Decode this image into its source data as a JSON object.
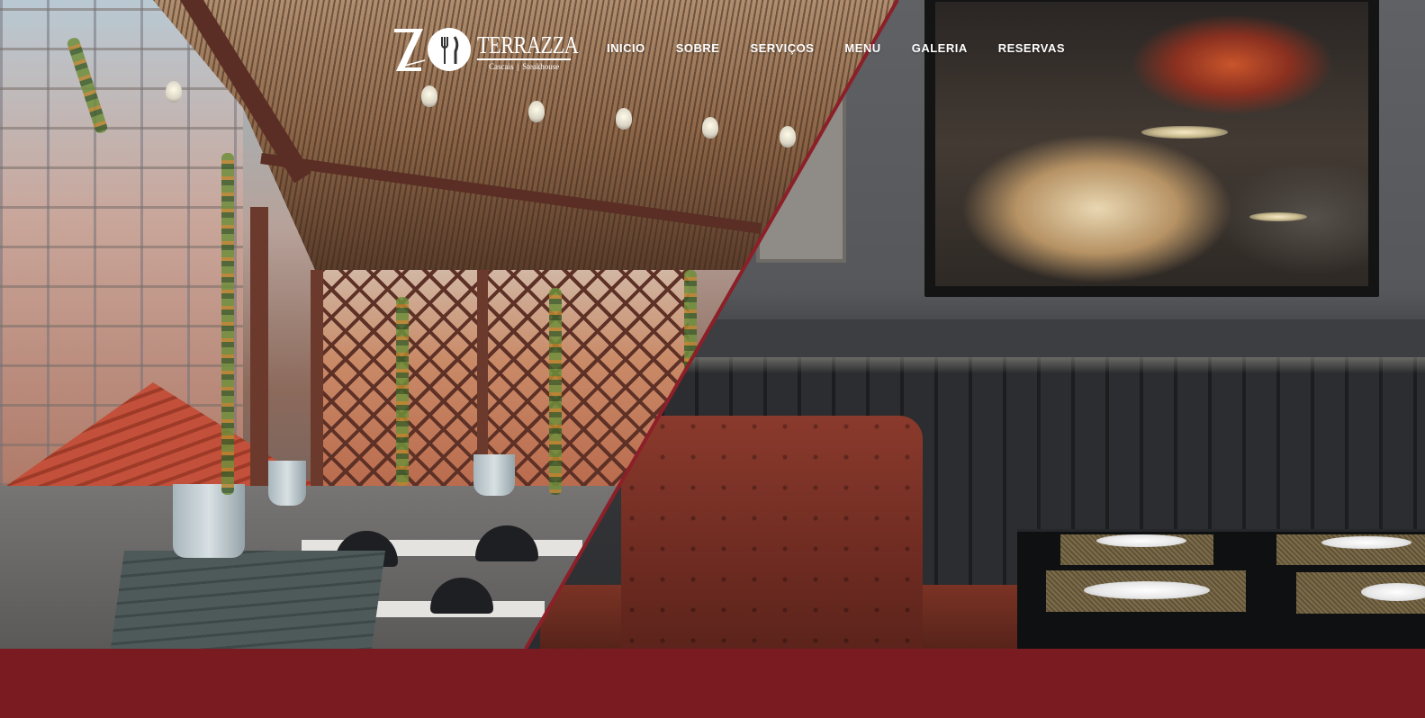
{
  "brand": {
    "mark": "ZO",
    "name": "TERRAZZA",
    "sub_left": "Cascais",
    "sub_right": "Steakhouse"
  },
  "nav": {
    "items": [
      {
        "label": "INICIO"
      },
      {
        "label": "SOBRE"
      },
      {
        "label": "SERVIÇOS"
      },
      {
        "label": "MENU"
      },
      {
        "label": "GALERIA"
      },
      {
        "label": "RESERVAS"
      }
    ]
  },
  "colors": {
    "accent": "#7a1a21",
    "nav_text": "#ffffff"
  }
}
